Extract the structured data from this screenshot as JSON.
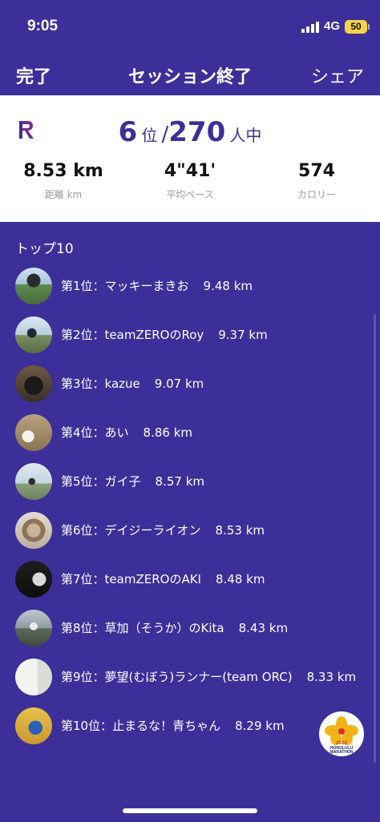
{
  "status_bar": {
    "time": "9:05",
    "network": "4G",
    "battery": "50"
  },
  "nav": {
    "done": "完了",
    "title": "セッション終了",
    "share": "シェア"
  },
  "summary": {
    "rank": "6",
    "rank_unit": "位",
    "separator": "/",
    "total": "270",
    "total_unit": "人中",
    "stats": [
      {
        "value": "8.53 km",
        "label": "距離 km"
      },
      {
        "value": "4\"41'",
        "label": "平均ペース"
      },
      {
        "value": "574",
        "label": "カロリー"
      }
    ]
  },
  "top10": {
    "header": "トップ10",
    "items": [
      {
        "label": "第1位：マッキーまきお",
        "distance": "9.48 km"
      },
      {
        "label": "第2位：teamZEROのRoy",
        "distance": "9.37 km"
      },
      {
        "label": "第3位：kazue",
        "distance": "9.07 km"
      },
      {
        "label": "第4位：あい",
        "distance": "8.86 km"
      },
      {
        "label": "第5位：ガイ子",
        "distance": "8.57 km"
      },
      {
        "label": "第6位：デイジーライオン",
        "distance": "8.53 km"
      },
      {
        "label": "第7位：teamZEROのAKI",
        "distance": "8.48 km"
      },
      {
        "label": "第8位：草加（そうか）のKita",
        "distance": "8.43 km"
      },
      {
        "label": "第9位：夢望(むぼう)ランナー(team ORC)",
        "distance": "8.33 km"
      },
      {
        "label": "第10位：止まるな！青ちゃん",
        "distance": "8.29 km"
      }
    ]
  },
  "badge": {
    "year": "2023",
    "line1": "HONOLULU",
    "line2": "MARATHON"
  },
  "colors": {
    "background": "#3d2f99",
    "card": "#ffffff",
    "accent": "#3d2f99",
    "muted": "#9a9a9a"
  }
}
